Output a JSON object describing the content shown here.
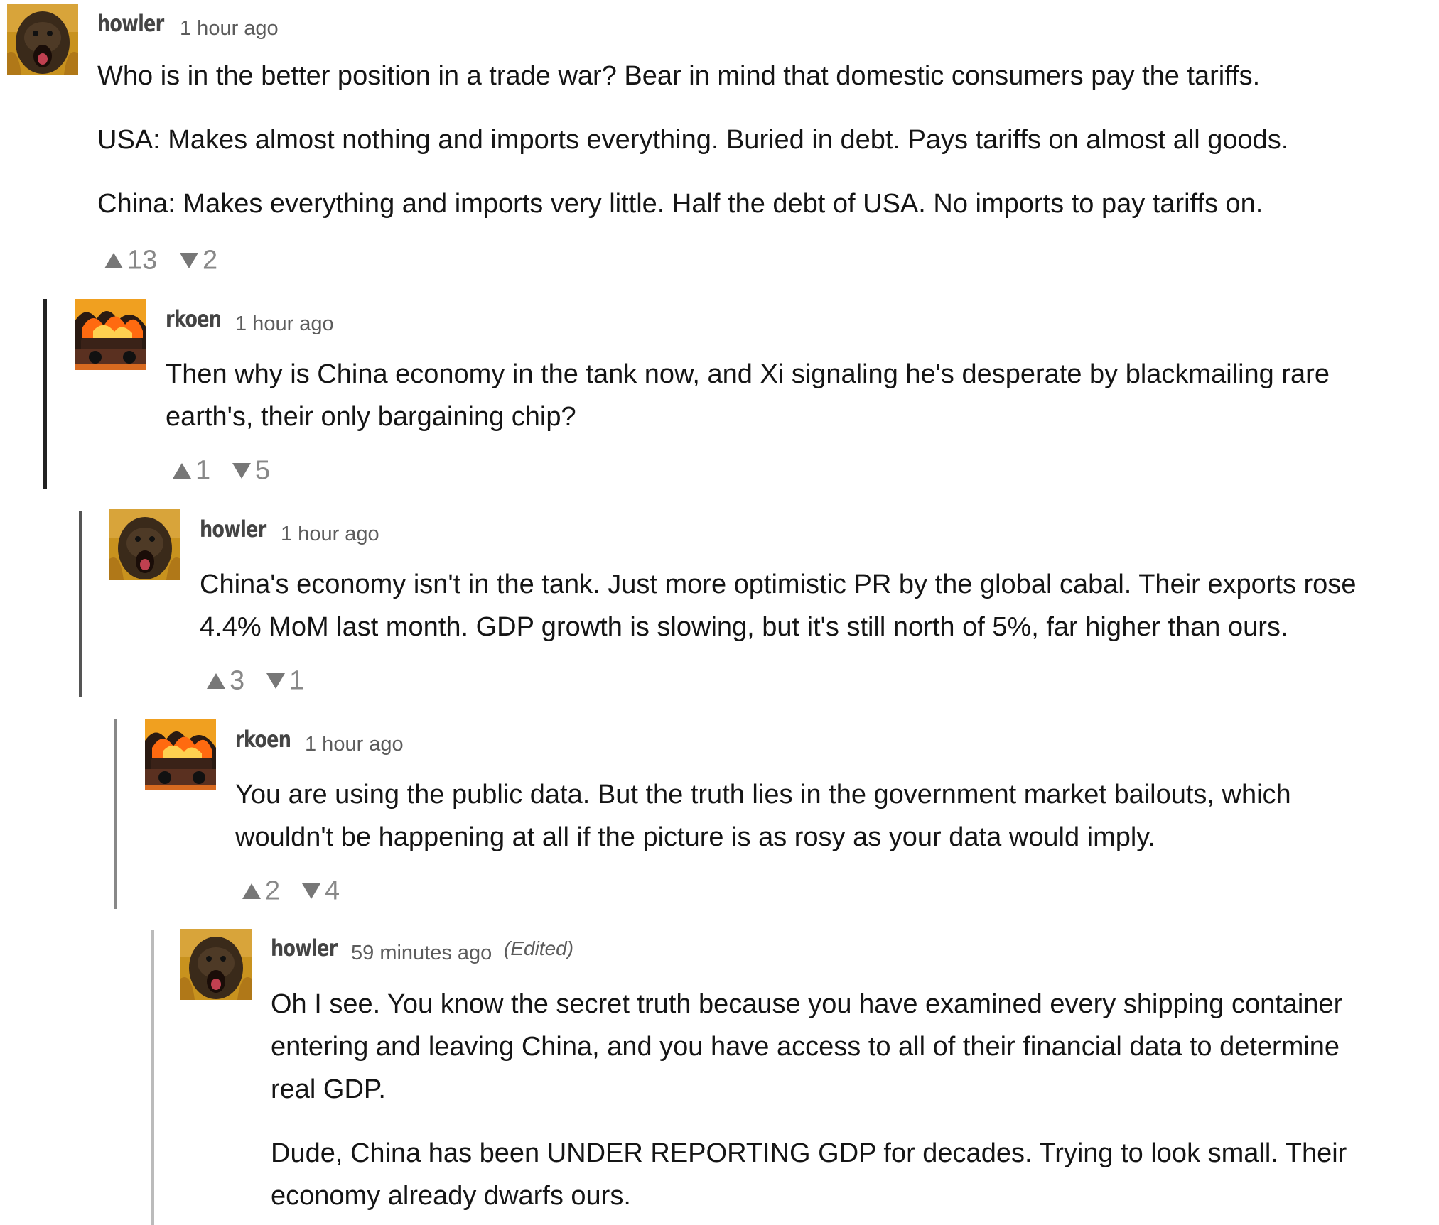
{
  "comments": [
    {
      "author": "howler",
      "time": "1 hour ago",
      "edited": "",
      "avatar_icon": "howler-monkey-avatar",
      "paragraphs": [
        "Who is in the better position in a trade war? Bear in mind that domestic consumers pay the tariffs.",
        "USA: Makes almost nothing and imports everything. Buried in debt. Pays tariffs on almost all goods.",
        "China: Makes everything and imports very little. Half the debt of USA. No imports to pay tariffs on."
      ],
      "upvotes": "13",
      "downvotes": "2"
    },
    {
      "author": "rkoen",
      "time": "1 hour ago",
      "edited": "",
      "avatar_icon": "burning-car-avatar",
      "paragraphs": [
        "Then why is China economy in the tank now, and Xi signaling he's desperate by blackmailing rare",
        "earth's, their only bargaining chip?"
      ],
      "upvotes": "1",
      "downvotes": "5"
    },
    {
      "author": "howler",
      "time": "1 hour ago",
      "edited": "",
      "avatar_icon": "howler-monkey-avatar",
      "paragraphs": [
        "China's economy isn't in the tank. Just more optimistic PR by the global cabal. Their exports rose",
        "4.4% MoM last month. GDP growth is slowing, but it's still north of 5%, far higher than ours."
      ],
      "upvotes": "3",
      "downvotes": "1"
    },
    {
      "author": "rkoen",
      "time": "1 hour ago",
      "edited": "",
      "avatar_icon": "burning-car-avatar",
      "paragraphs": [
        "You are using the public data.  But the truth lies in the government market bailouts, which",
        "wouldn't be happening at all if the picture is as rosy as your data would imply."
      ],
      "upvotes": "2",
      "downvotes": "4"
    },
    {
      "author": "howler",
      "time": "59 minutes ago",
      "edited": "(Edited)",
      "avatar_icon": "howler-monkey-avatar",
      "paragraphs": [
        "Oh I see. You know the secret truth because you have examined every shipping container",
        "entering and leaving China, and you have access to all of their financial data to determine",
        "real GDP.",
        "Dude, China has been UNDER REPORTING GDP for decades. Trying to look small. Their",
        "economy already dwarfs ours."
      ],
      "upvotes": "",
      "downvotes": ""
    }
  ],
  "colors": {
    "thread_bars": [
      "#222222",
      "#555555",
      "#888888",
      "#bbbbbb"
    ],
    "vote_arrow": "#777777"
  }
}
